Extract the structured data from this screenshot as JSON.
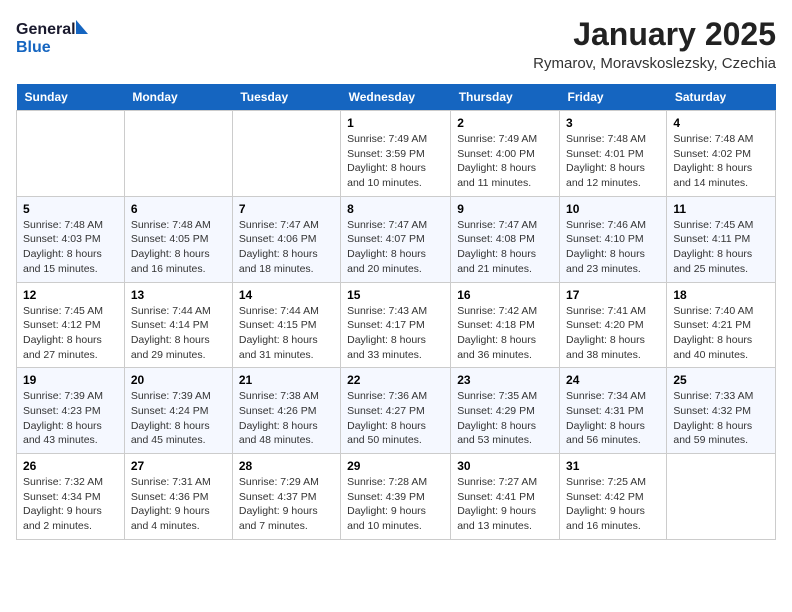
{
  "header": {
    "logo_general": "General",
    "logo_blue": "Blue",
    "title": "January 2025",
    "subtitle": "Rymarov, Moravskoslezsky, Czechia"
  },
  "weekdays": [
    "Sunday",
    "Monday",
    "Tuesday",
    "Wednesday",
    "Thursday",
    "Friday",
    "Saturday"
  ],
  "weeks": [
    [
      {
        "day": "",
        "info": ""
      },
      {
        "day": "",
        "info": ""
      },
      {
        "day": "",
        "info": ""
      },
      {
        "day": "1",
        "info": "Sunrise: 7:49 AM\nSunset: 3:59 PM\nDaylight: 8 hours\nand 10 minutes."
      },
      {
        "day": "2",
        "info": "Sunrise: 7:49 AM\nSunset: 4:00 PM\nDaylight: 8 hours\nand 11 minutes."
      },
      {
        "day": "3",
        "info": "Sunrise: 7:48 AM\nSunset: 4:01 PM\nDaylight: 8 hours\nand 12 minutes."
      },
      {
        "day": "4",
        "info": "Sunrise: 7:48 AM\nSunset: 4:02 PM\nDaylight: 8 hours\nand 14 minutes."
      }
    ],
    [
      {
        "day": "5",
        "info": "Sunrise: 7:48 AM\nSunset: 4:03 PM\nDaylight: 8 hours\nand 15 minutes."
      },
      {
        "day": "6",
        "info": "Sunrise: 7:48 AM\nSunset: 4:05 PM\nDaylight: 8 hours\nand 16 minutes."
      },
      {
        "day": "7",
        "info": "Sunrise: 7:47 AM\nSunset: 4:06 PM\nDaylight: 8 hours\nand 18 minutes."
      },
      {
        "day": "8",
        "info": "Sunrise: 7:47 AM\nSunset: 4:07 PM\nDaylight: 8 hours\nand 20 minutes."
      },
      {
        "day": "9",
        "info": "Sunrise: 7:47 AM\nSunset: 4:08 PM\nDaylight: 8 hours\nand 21 minutes."
      },
      {
        "day": "10",
        "info": "Sunrise: 7:46 AM\nSunset: 4:10 PM\nDaylight: 8 hours\nand 23 minutes."
      },
      {
        "day": "11",
        "info": "Sunrise: 7:45 AM\nSunset: 4:11 PM\nDaylight: 8 hours\nand 25 minutes."
      }
    ],
    [
      {
        "day": "12",
        "info": "Sunrise: 7:45 AM\nSunset: 4:12 PM\nDaylight: 8 hours\nand 27 minutes."
      },
      {
        "day": "13",
        "info": "Sunrise: 7:44 AM\nSunset: 4:14 PM\nDaylight: 8 hours\nand 29 minutes."
      },
      {
        "day": "14",
        "info": "Sunrise: 7:44 AM\nSunset: 4:15 PM\nDaylight: 8 hours\nand 31 minutes."
      },
      {
        "day": "15",
        "info": "Sunrise: 7:43 AM\nSunset: 4:17 PM\nDaylight: 8 hours\nand 33 minutes."
      },
      {
        "day": "16",
        "info": "Sunrise: 7:42 AM\nSunset: 4:18 PM\nDaylight: 8 hours\nand 36 minutes."
      },
      {
        "day": "17",
        "info": "Sunrise: 7:41 AM\nSunset: 4:20 PM\nDaylight: 8 hours\nand 38 minutes."
      },
      {
        "day": "18",
        "info": "Sunrise: 7:40 AM\nSunset: 4:21 PM\nDaylight: 8 hours\nand 40 minutes."
      }
    ],
    [
      {
        "day": "19",
        "info": "Sunrise: 7:39 AM\nSunset: 4:23 PM\nDaylight: 8 hours\nand 43 minutes."
      },
      {
        "day": "20",
        "info": "Sunrise: 7:39 AM\nSunset: 4:24 PM\nDaylight: 8 hours\nand 45 minutes."
      },
      {
        "day": "21",
        "info": "Sunrise: 7:38 AM\nSunset: 4:26 PM\nDaylight: 8 hours\nand 48 minutes."
      },
      {
        "day": "22",
        "info": "Sunrise: 7:36 AM\nSunset: 4:27 PM\nDaylight: 8 hours\nand 50 minutes."
      },
      {
        "day": "23",
        "info": "Sunrise: 7:35 AM\nSunset: 4:29 PM\nDaylight: 8 hours\nand 53 minutes."
      },
      {
        "day": "24",
        "info": "Sunrise: 7:34 AM\nSunset: 4:31 PM\nDaylight: 8 hours\nand 56 minutes."
      },
      {
        "day": "25",
        "info": "Sunrise: 7:33 AM\nSunset: 4:32 PM\nDaylight: 8 hours\nand 59 minutes."
      }
    ],
    [
      {
        "day": "26",
        "info": "Sunrise: 7:32 AM\nSunset: 4:34 PM\nDaylight: 9 hours\nand 2 minutes."
      },
      {
        "day": "27",
        "info": "Sunrise: 7:31 AM\nSunset: 4:36 PM\nDaylight: 9 hours\nand 4 minutes."
      },
      {
        "day": "28",
        "info": "Sunrise: 7:29 AM\nSunset: 4:37 PM\nDaylight: 9 hours\nand 7 minutes."
      },
      {
        "day": "29",
        "info": "Sunrise: 7:28 AM\nSunset: 4:39 PM\nDaylight: 9 hours\nand 10 minutes."
      },
      {
        "day": "30",
        "info": "Sunrise: 7:27 AM\nSunset: 4:41 PM\nDaylight: 9 hours\nand 13 minutes."
      },
      {
        "day": "31",
        "info": "Sunrise: 7:25 AM\nSunset: 4:42 PM\nDaylight: 9 hours\nand 16 minutes."
      },
      {
        "day": "",
        "info": ""
      }
    ]
  ]
}
